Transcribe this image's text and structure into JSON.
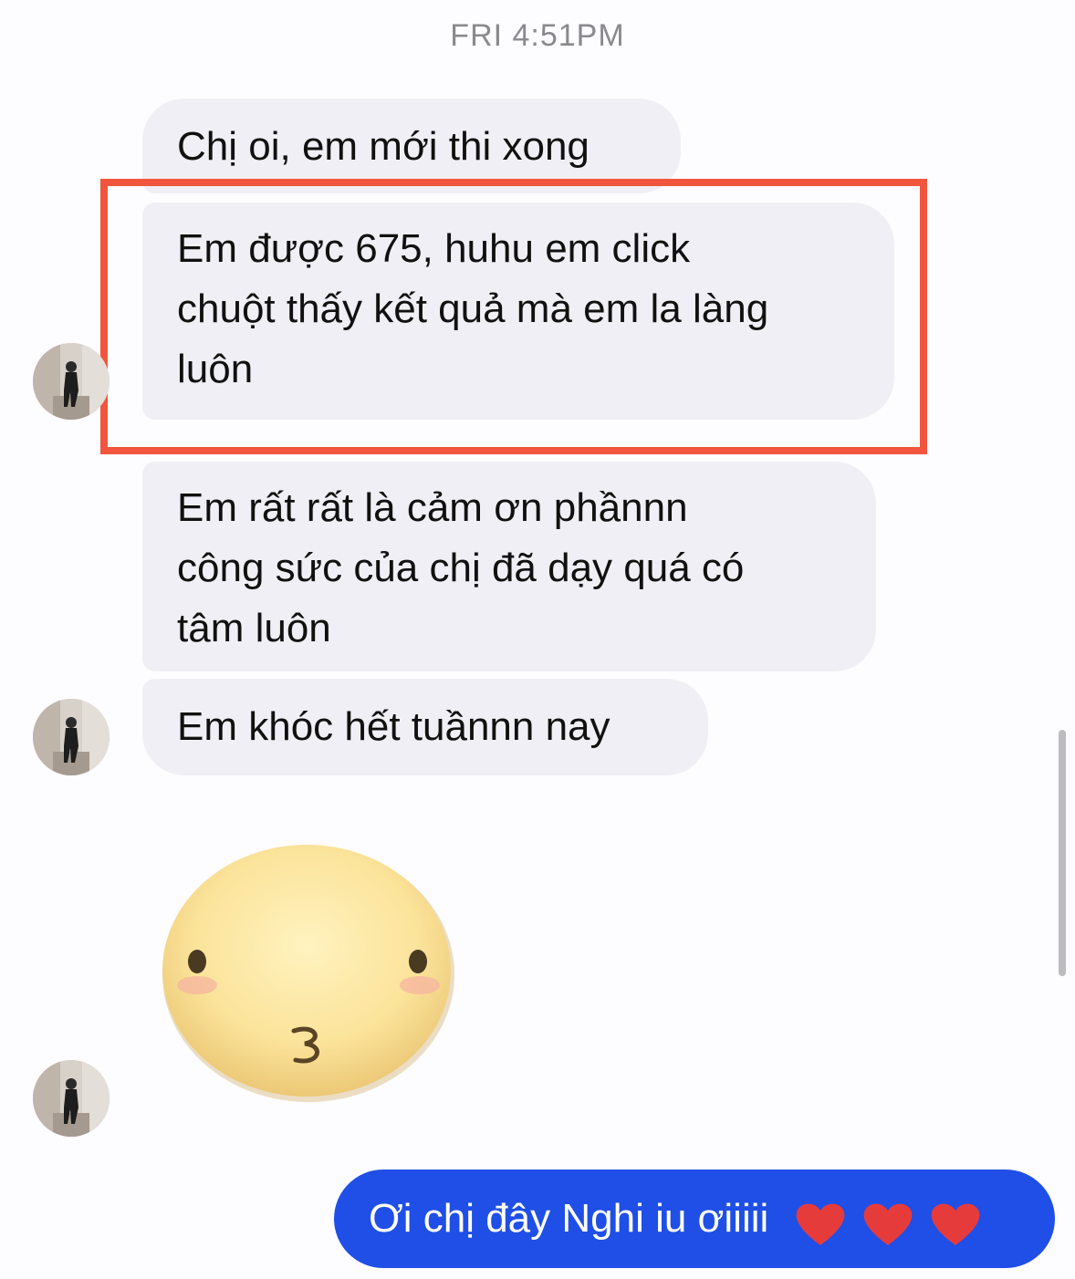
{
  "header": {
    "timestamp": "FRI 4:51PM"
  },
  "messages": {
    "m1": "Chị oi, em mới thi xong",
    "m2_line1": "Em được 675, huhu em click",
    "m2_line2": "chuột thấy kết quả mà em la làng",
    "m2_line3": "luôn",
    "m3_line1": "Em rất rất là cảm ơn phầnnn",
    "m3_line2": "công sức của chị đã dạy quá có",
    "m3_line3": "tâm luôn",
    "m4": "Em khóc hết tuầnnn nay"
  },
  "sticker": {
    "icon": "kiss-face-sticker"
  },
  "reply": {
    "text": "Ơi chị đây Nghi iu ơiiiii",
    "emoji": "❤️❤️❤️"
  },
  "colors": {
    "outgoing_bubble": "#1f4fe6",
    "incoming_bubble": "#f0eff5",
    "highlight_box": "#f1553d"
  }
}
